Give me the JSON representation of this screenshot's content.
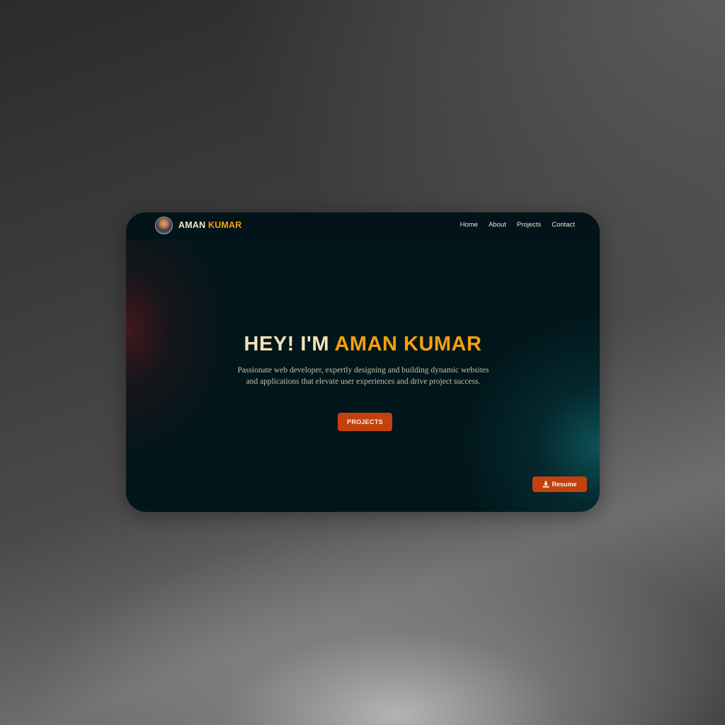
{
  "header": {
    "brand_first": "AMAN",
    "brand_last": "KUMAR",
    "avatar_icon": "user-avatar-photo",
    "nav": [
      "Home",
      "About",
      "Projects",
      "Contact"
    ]
  },
  "hero": {
    "title_prefix": "HEY! I'M",
    "title_name": "AMAN KUMAR",
    "description": "Passionate web developer, expertly designing and building dynamic websites and applications that elevate user experiences and drive project success.",
    "cta_label": "PROJECTS"
  },
  "resume": {
    "label": "Resume",
    "icon": "download-icon"
  },
  "colors": {
    "accent": "#f5a00b",
    "button": "#c2410c",
    "background": "#01161b"
  }
}
